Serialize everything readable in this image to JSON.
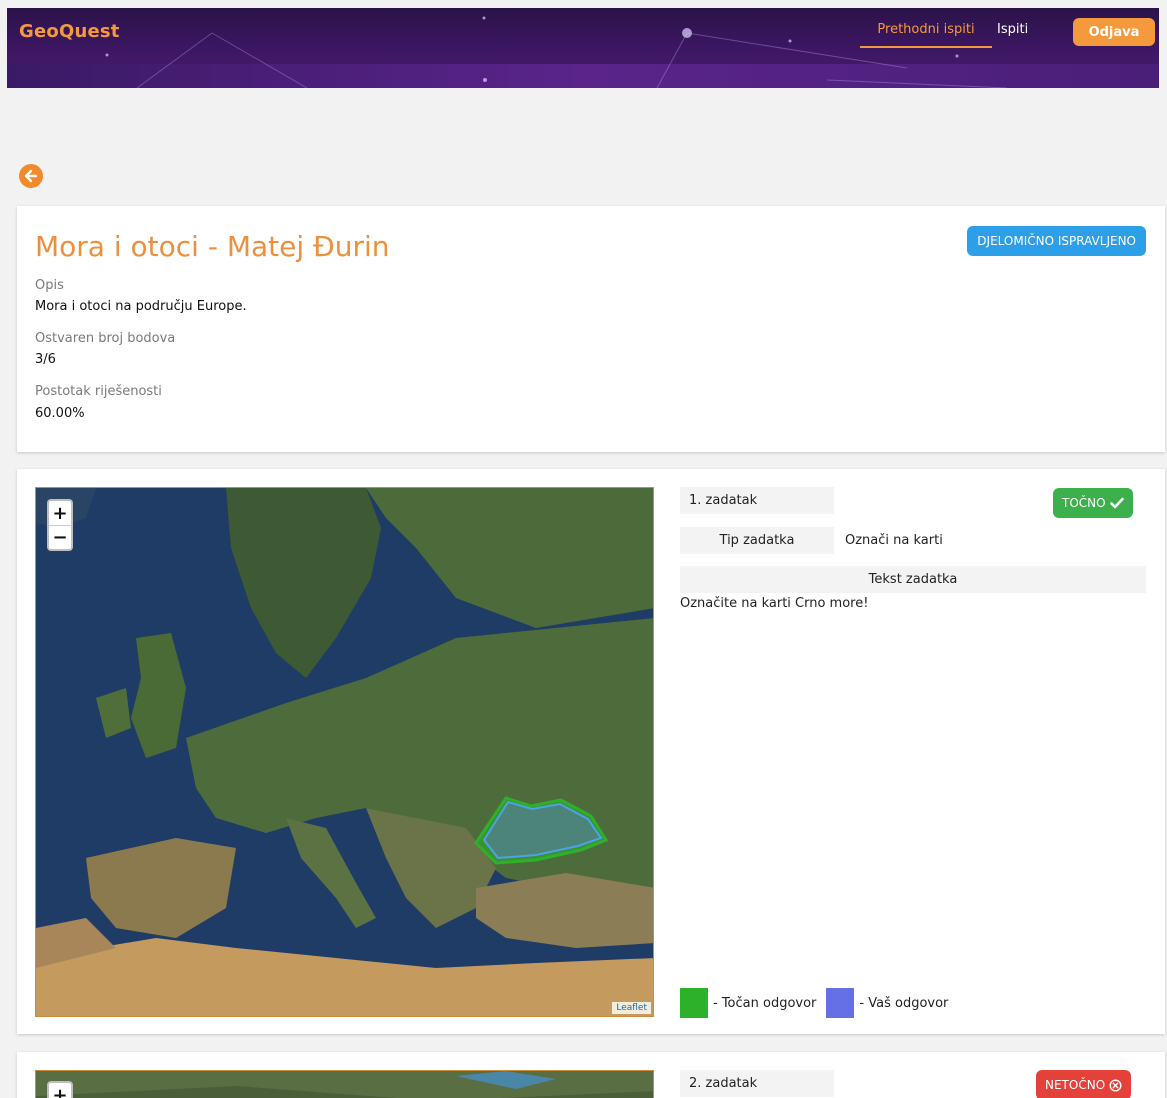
{
  "header": {
    "brand": "GeoQuest",
    "nav_previous": "Prethodni ispiti",
    "nav_exams": "Ispiti",
    "logout": "Odjava",
    "accent": "#f59a3c"
  },
  "summary": {
    "title": "Mora i otoci - Matej Đurin",
    "status": "DJELOMIČNO ISPRAVLJENO",
    "description_label": "Opis",
    "description": "Mora i otoci na području Europe.",
    "points_label": "Ostvaren broj bodova",
    "points": "3/6",
    "percent_label": "Postotak riješenosti",
    "percent": "60.00%"
  },
  "tasks": [
    {
      "label": "1. zadatak",
      "status": "TOČNO",
      "status_color": "#3cb04a",
      "type_key": "Tip zadatka",
      "type_value": "Označi na karti",
      "text_key": "Tekst zadatka",
      "text_value": "Označite na karti Crno more!",
      "map_attribution": "Leaflet",
      "zoom_in": "+",
      "zoom_out": "−"
    },
    {
      "label": "2. zadatak",
      "status": "NETOČNO",
      "status_color": "#e3413a",
      "zoom_in": "+"
    }
  ],
  "legend": {
    "correct_label": "- Točan odgovor",
    "correct_color": "#2db02a",
    "yours_label": "- Vaš odgovor",
    "yours_color": "#6570e6"
  }
}
